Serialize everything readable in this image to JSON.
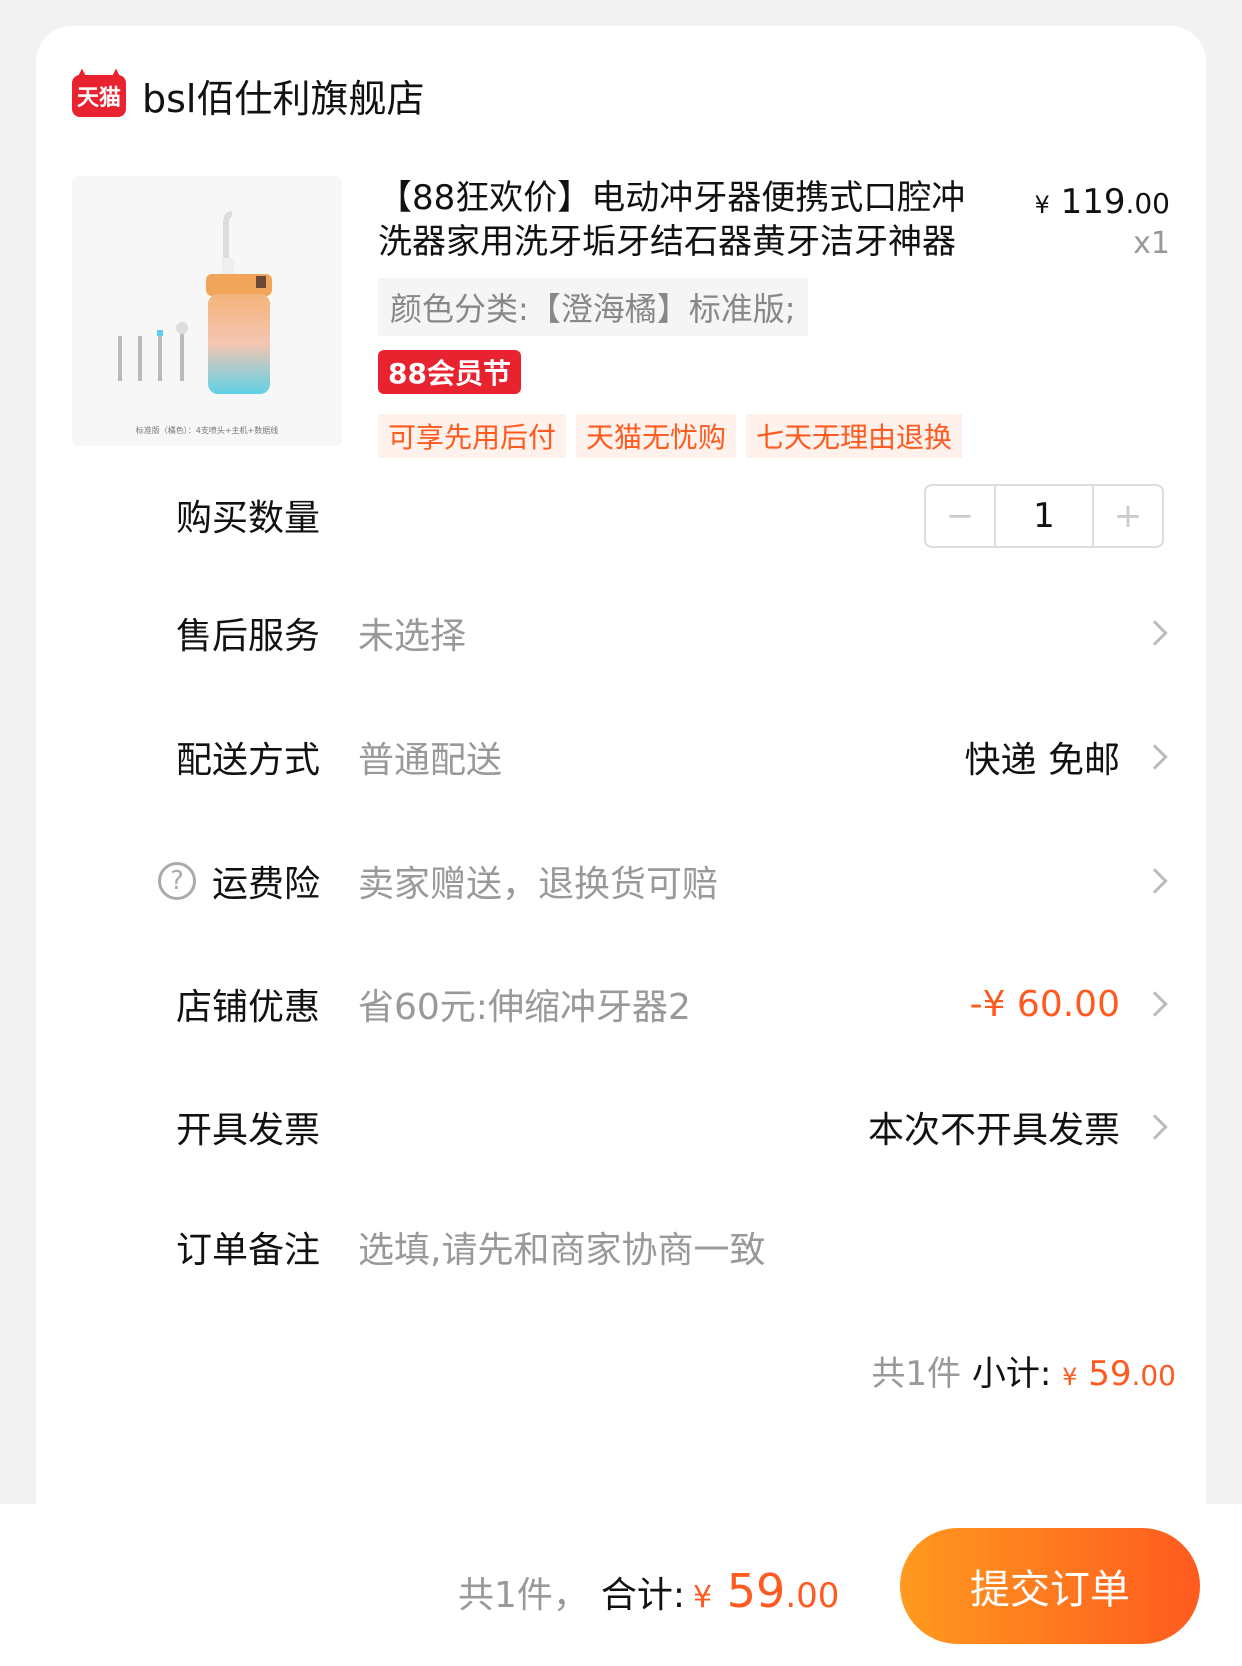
{
  "shop": {
    "platform_logo": "天猫",
    "name": "bsl佰仕利旗舰店"
  },
  "product": {
    "title": "【88狂欢价】电动冲牙器便携式口腔冲洗器家用洗牙垢牙结石器黄牙洁牙神器",
    "price_symbol": "¥",
    "price_int": "119",
    "price_dec": ".00",
    "quantity_label": "x1",
    "sku": "颜色分类:【澄海橘】标准版;",
    "badge": "88会员节",
    "image_caption": "标准版（橘色）：4支喷头+主机+数据线",
    "service_tags": [
      "可享先用后付",
      "天猫无忧购",
      "七天无理由退换"
    ]
  },
  "rows": {
    "quantity": {
      "label": "购买数量",
      "value": "1",
      "minus": "−",
      "plus": "+"
    },
    "after_sales": {
      "label": "售后服务",
      "value": "未选择"
    },
    "delivery": {
      "label": "配送方式",
      "value": "普通配送",
      "right": "快递 免邮"
    },
    "insurance": {
      "label": "运费险",
      "value": "卖家赠送，退换货可赔",
      "help": "?"
    },
    "discount": {
      "label": "店铺优惠",
      "value": "省60元:伸缩冲牙器2",
      "right": "-¥ 60.00"
    },
    "invoice": {
      "label": "开具发票",
      "right": "本次不开具发票"
    },
    "remark": {
      "label": "订单备注",
      "placeholder": "选填,请先和商家协商一致"
    }
  },
  "subtotal": {
    "count": "共1件",
    "label": "小计:",
    "symbol": "¥",
    "int": "59",
    "dec": ".00"
  },
  "footer": {
    "count": "共1件，",
    "label": "合计:",
    "symbol": "¥",
    "int": "59",
    "dec": ".00",
    "submit": "提交订单"
  },
  "colors": {
    "accent": "#ff5a1f",
    "tmall_red": "#e8232f"
  }
}
